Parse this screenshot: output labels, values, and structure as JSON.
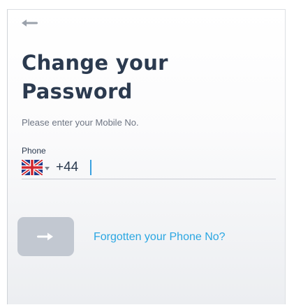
{
  "header": {
    "back_icon": "back-arrow-icon"
  },
  "title": {
    "line1": "Change your",
    "line2": "Password"
  },
  "subtitle": "Please enter your Mobile No.",
  "phone": {
    "label": "Phone",
    "country_icon": "uk-flag-icon",
    "value": "+44"
  },
  "actions": {
    "next_icon": "right-arrow-icon",
    "forgot_link": "Forgotten your Phone No?"
  },
  "colors": {
    "title": "#2b3a4f",
    "link": "#2aa6e2",
    "button_disabled": "#c2c8d1",
    "cursor": "#3aa0e0"
  }
}
